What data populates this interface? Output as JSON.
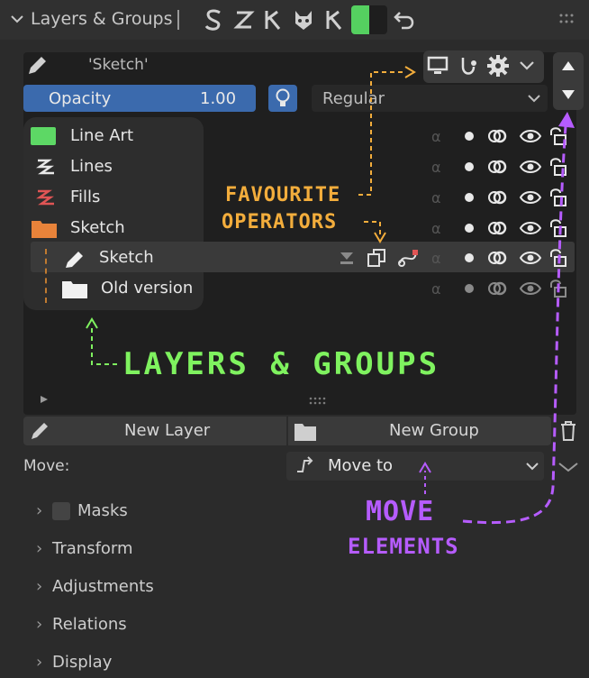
{
  "header": {
    "title": "Layers & Groups",
    "icons": [
      "grease-pencil-s-icon",
      "grease-pencil-z-icon",
      "key-icon",
      "cat-icon",
      "key-alt-icon",
      "color-swatch",
      "undo-icon",
      "grip-icon"
    ]
  },
  "layer": {
    "name": "'Sketch'",
    "opacity_label": "Opacity",
    "opacity_value": "1.00",
    "blend_mode": "Regular"
  },
  "tree": {
    "items": [
      {
        "label": "Line Art",
        "icon": "green-rect-icon"
      },
      {
        "label": "Lines",
        "icon": "lines-stroke-icon"
      },
      {
        "label": "Fills",
        "icon": "fills-stroke-icon"
      },
      {
        "label": "Sketch",
        "icon": "orange-folder-icon"
      },
      {
        "label": "Sketch",
        "icon": "pencil-icon"
      },
      {
        "label": "Old version",
        "icon": "white-folder-icon"
      }
    ]
  },
  "buttons": {
    "new_layer": "New Layer",
    "new_group": "New Group"
  },
  "move": {
    "label": "Move:",
    "value": "Move to"
  },
  "sections": [
    {
      "label": "Masks"
    },
    {
      "label": "Transform"
    },
    {
      "label": "Adjustments"
    },
    {
      "label": "Relations"
    },
    {
      "label": "Display"
    }
  ],
  "annotations": {
    "favourite_line1": "FAVOURITE",
    "favourite_line2": "OPERATORS",
    "layers_groups": "LAYERS & GROUPS",
    "move_line1": "MOVE",
    "move_line2": "ELEMENTS"
  },
  "colors": {
    "accent_blue": "#3b6aad",
    "annotation_orange": "#f3ad3c",
    "annotation_green": "#7ff25f",
    "annotation_purple": "#b65cff"
  }
}
